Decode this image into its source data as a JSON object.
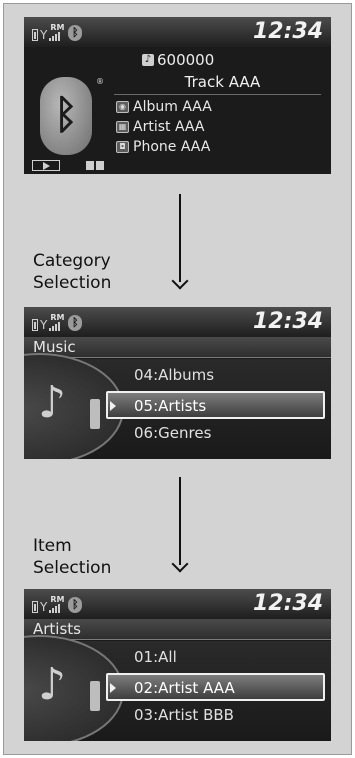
{
  "status": {
    "time": "12:34",
    "roaming": "RM",
    "bluetooth": "bluetooth-icon"
  },
  "now_playing": {
    "track_number": "600000",
    "track_title": "Track AAA",
    "album": "Album AAA",
    "artist": "Artist AAA",
    "phone": "Phone AAA"
  },
  "steps": {
    "category_label": "Category\nSelection",
    "item_label": "Item\nSelection"
  },
  "category_screen": {
    "title": "Music",
    "items": [
      "04:Albums",
      "05:Artists",
      "06:Genres"
    ],
    "selected_index": 1
  },
  "item_screen": {
    "title": "Artists",
    "items": [
      "01:All",
      "02:Artist AAA",
      "03:Artist BBB"
    ],
    "selected_index": 1
  },
  "colors": {
    "screen_bg": "#1b1b1b",
    "frame_bg": "#d3d3d3",
    "text": "#e8e8e8"
  }
}
